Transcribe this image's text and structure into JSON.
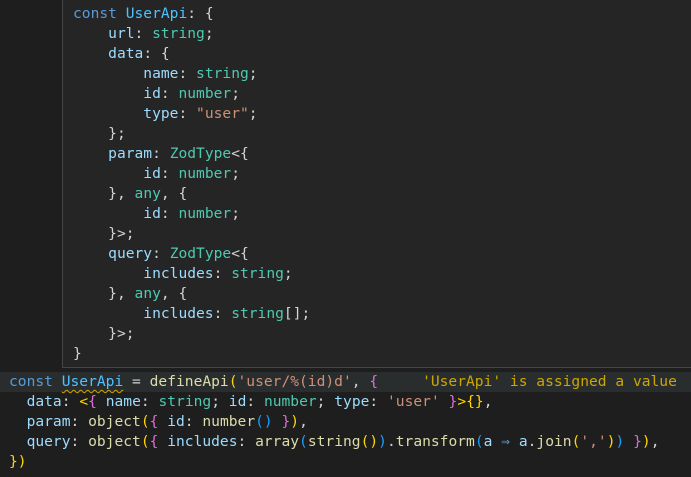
{
  "hover": {
    "lines": [
      "const UserApi: {",
      "    url: string;",
      "    data: {",
      "        name: string;",
      "        id: number;",
      "        type: \"user\";",
      "    };",
      "    param: ZodType<{",
      "        id: number;",
      "    }, any, {",
      "        id: number;",
      "    }>;",
      "    query: ZodType<{",
      "        includes: string;",
      "    }, any, {",
      "        includes: string[];",
      "    }>;",
      "}"
    ]
  },
  "editor": {
    "diagnostic": "'UserApi' is assigned a value",
    "lines": [
      "const UserApi = defineApi('user/%(id)d', {",
      "  data: <{ name: string; id: number; type: 'user' }>{},",
      "  param: object({ id: number() }),",
      "  query: object({ includes: array(string()).transform(a ⇒ a.join(',')) }),",
      "})"
    ]
  },
  "colors": {
    "background": "#1e1e1e",
    "hover_background": "#252526",
    "keyword": "#569cd6",
    "property": "#9cdcfe",
    "type": "#4ec9b0",
    "string": "#ce9178",
    "function": "#dcdcaa",
    "warning": "#cca700"
  }
}
